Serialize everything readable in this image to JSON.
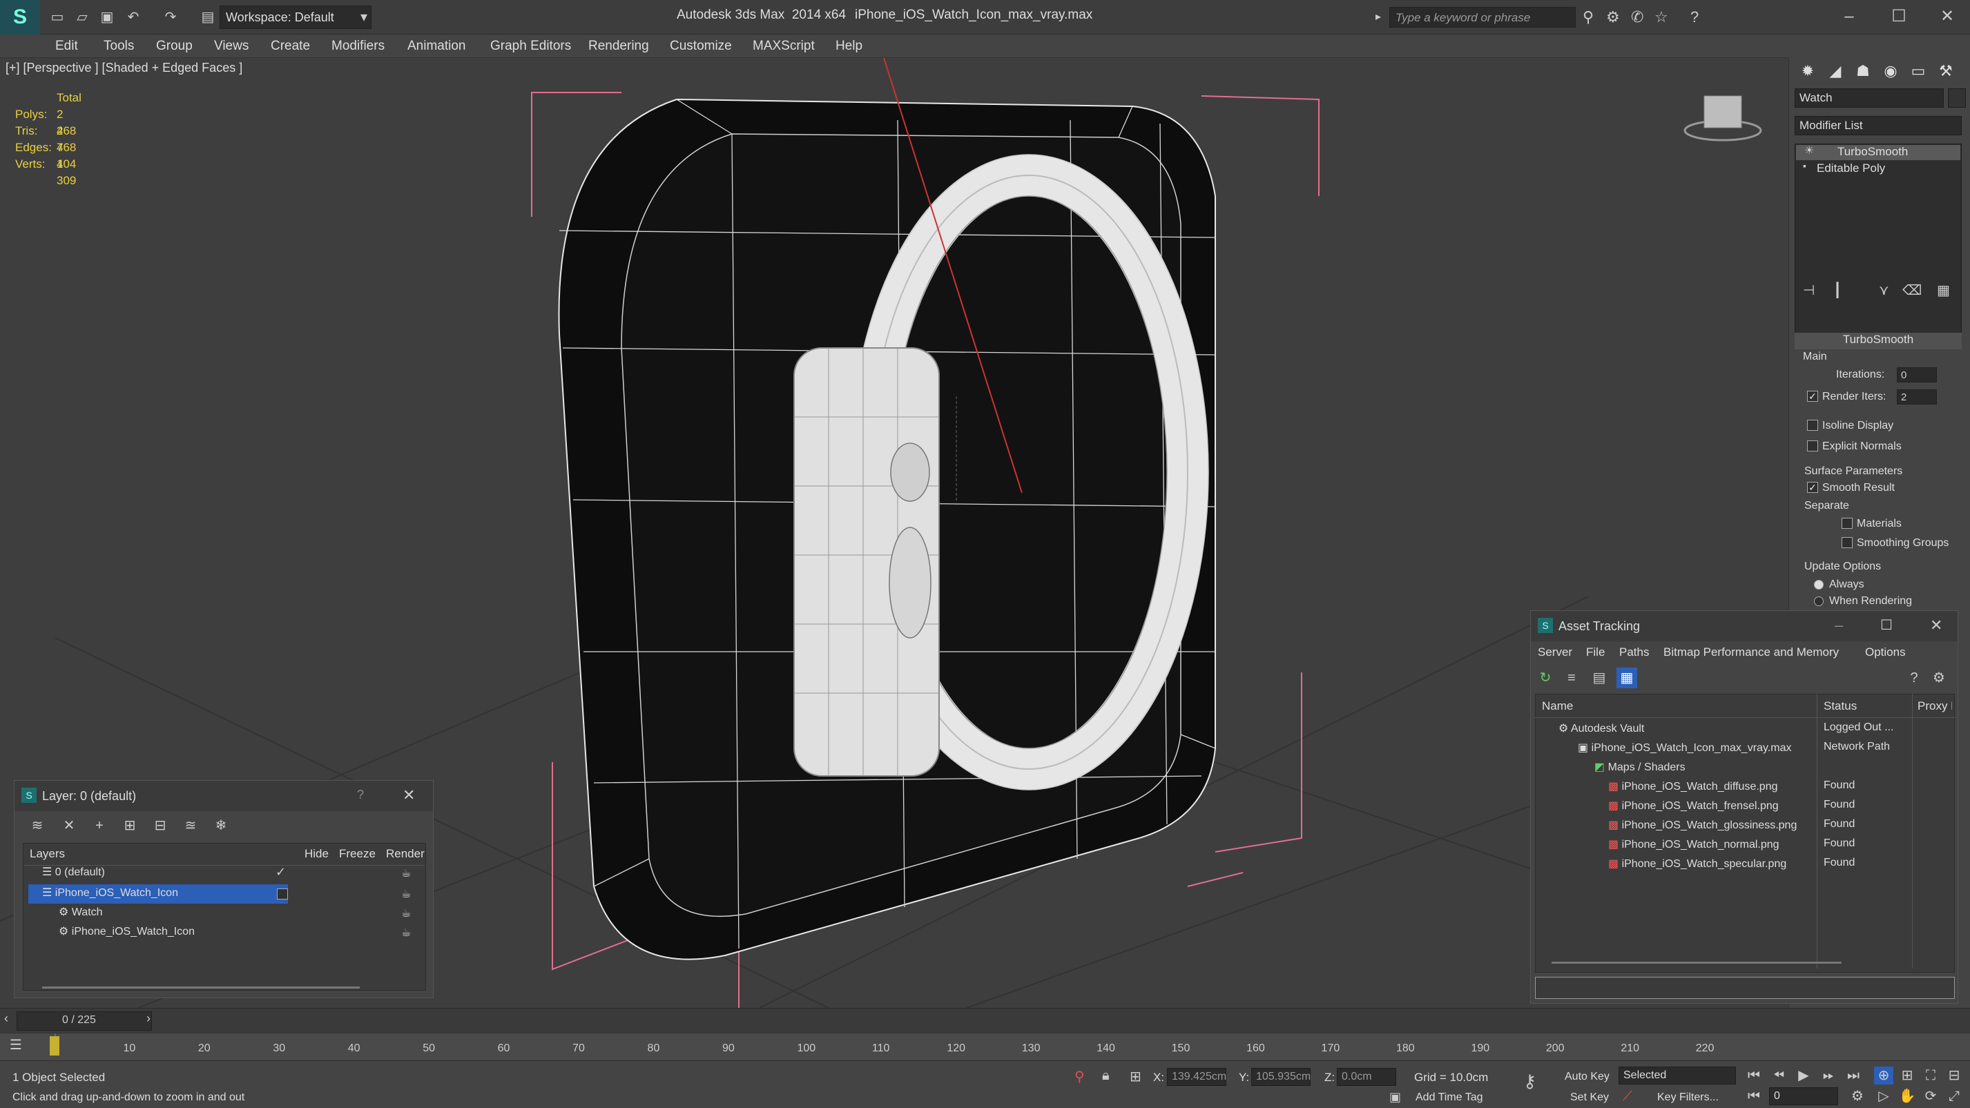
{
  "titlebar": {
    "app_title": "Autodesk 3ds Max  2014 x64",
    "file_title": "iPhone_iOS_Watch_Icon_max_vray.max",
    "workspace": "Workspace: Default",
    "search_placeholder": "Type a keyword or phrase"
  },
  "menu": [
    "Edit",
    "Tools",
    "Group",
    "Views",
    "Create",
    "Modifiers",
    "Animation",
    "Graph Editors",
    "Rendering",
    "Customize",
    "MAXScript",
    "Help"
  ],
  "viewport": {
    "label": "[+] [Perspective ] [Shaded + Edged Faces ]",
    "stats": {
      "total_label": "Total",
      "rows": [
        {
          "k": "Polys:",
          "v": "2 468"
        },
        {
          "k": "Tris:",
          "v": "2 468"
        },
        {
          "k": "Edges:",
          "v": "7 404"
        },
        {
          "k": "Verts:",
          "v": "1 309"
        }
      ]
    }
  },
  "command_panel": {
    "object_name": "Watch",
    "modifier_list": "Modifier List",
    "stack": [
      "TurboSmooth",
      "Editable Poly"
    ],
    "rollout_title": "TurboSmooth",
    "main_label": "Main",
    "iterations_label": "Iterations:",
    "iterations_value": "0",
    "render_iters_label": "Render Iters:",
    "render_iters_value": "2",
    "isoline": "Isoline Display",
    "explicit_normals": "Explicit Normals",
    "surface_params": "Surface Parameters",
    "smooth_result": "Smooth Result",
    "separate": "Separate",
    "materials": "Materials",
    "smoothing_groups": "Smoothing Groups",
    "update_options": "Update Options",
    "always": "Always",
    "when_rendering": "When Rendering"
  },
  "layer_dialog": {
    "title": "Layer: 0 (default)",
    "help": "?",
    "columns": [
      "Layers",
      "Hide",
      "Freeze",
      "Render"
    ],
    "rows": [
      {
        "name": "0 (default)",
        "indent": 0
      },
      {
        "name": "iPhone_iOS_Watch_Icon",
        "indent": 0
      },
      {
        "name": "Watch",
        "indent": 1
      },
      {
        "name": "iPhone_iOS_Watch_Icon",
        "indent": 1
      }
    ]
  },
  "asset_tracking": {
    "title": "Asset Tracking",
    "menu": [
      "Server",
      "File",
      "Paths",
      "Bitmap Performance and Memory",
      "Options"
    ],
    "columns": [
      "Name",
      "Status",
      "Proxy R"
    ],
    "rows": [
      {
        "name": "Autodesk Vault",
        "status": "Logged Out ...",
        "indent": 0
      },
      {
        "name": "iPhone_iOS_Watch_Icon_max_vray.max",
        "status": "Network Path",
        "indent": 1
      },
      {
        "name": "Maps / Shaders",
        "status": "",
        "indent": 2
      },
      {
        "name": "iPhone_iOS_Watch_diffuse.png",
        "status": "Found",
        "indent": 3
      },
      {
        "name": "iPhone_iOS_Watch_frensel.png",
        "status": "Found",
        "indent": 3
      },
      {
        "name": "iPhone_iOS_Watch_glossiness.png",
        "status": "Found",
        "indent": 3
      },
      {
        "name": "iPhone_iOS_Watch_normal.png",
        "status": "Found",
        "indent": 3
      },
      {
        "name": "iPhone_iOS_Watch_specular.png",
        "status": "Found",
        "indent": 3
      }
    ]
  },
  "timeline": {
    "frame": "0 / 225",
    "ticks": [
      "10",
      "20",
      "30",
      "40",
      "50",
      "60",
      "70",
      "80",
      "90",
      "100",
      "110",
      "120",
      "130",
      "140",
      "150",
      "160",
      "170",
      "180",
      "190",
      "200",
      "210",
      "220"
    ]
  },
  "status": {
    "selected": "1 Object Selected",
    "prompt": "Click and drag up-and-down to zoom in and out",
    "x_label": "X:",
    "x_value": "139.425cm",
    "y_label": "Y:",
    "y_value": "105.935cm",
    "z_label": "Z:",
    "z_value": "0.0cm",
    "grid": "Grid = 10.0cm",
    "add_time_tag": "Add Time Tag",
    "auto_key": "Auto Key",
    "selected_mode": "Selected",
    "set_key": "Set Key",
    "key_filters": "Key Filters...",
    "frame_field": "0"
  }
}
